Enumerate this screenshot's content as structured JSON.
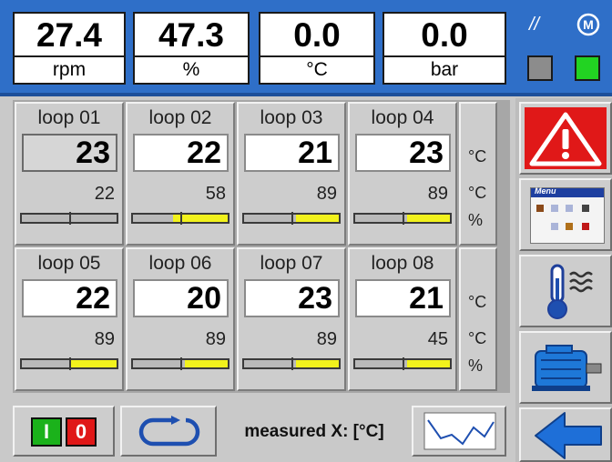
{
  "readouts": [
    {
      "value": "27.4",
      "unit": "rpm"
    },
    {
      "value": "47.3",
      "unit": "%"
    },
    {
      "value": "0.0",
      "unit": "°C"
    },
    {
      "value": "0.0",
      "unit": "bar"
    }
  ],
  "status": {
    "mode_icon_text": "//",
    "m_icon_text": "M",
    "indicator_left_color": "#8c8c8c",
    "indicator_right_color": "#22d322"
  },
  "loops": [
    {
      "name": "loop 01",
      "setpoint": "23",
      "measured": "22",
      "level": 0.0,
      "selected": true
    },
    {
      "name": "loop 02",
      "setpoint": "22",
      "measured": "58",
      "level": 0.58,
      "selected": false
    },
    {
      "name": "loop 03",
      "setpoint": "21",
      "measured": "89",
      "level": 0.45,
      "selected": false
    },
    {
      "name": "loop 04",
      "setpoint": "23",
      "measured": "89",
      "level": 0.45,
      "selected": false
    },
    {
      "name": "loop 05",
      "setpoint": "22",
      "measured": "89",
      "level": 0.48,
      "selected": false
    },
    {
      "name": "loop 06",
      "setpoint": "20",
      "measured": "89",
      "level": 0.45,
      "selected": false
    },
    {
      "name": "loop 07",
      "setpoint": "23",
      "measured": "89",
      "level": 0.45,
      "selected": false
    },
    {
      "name": "loop 08",
      "setpoint": "21",
      "measured": "45",
      "level": 0.45,
      "selected": false
    }
  ],
  "units": {
    "setpoint": "°C",
    "measured": "°C",
    "output": "%"
  },
  "toolbar": {
    "on_label": "I",
    "off_label": "0",
    "measured_label": "measured X: [°C]"
  },
  "colors": {
    "header_blue": "#2f6fc8",
    "warning_red": "#e01818",
    "bar_yellow": "#f2f21c",
    "arrow_blue": "#1e6fd8"
  },
  "icons": {
    "alarm": "warning-triangle-icon",
    "menu": "menu-icon",
    "temperature": "thermometer-icon",
    "motor": "motor-icon",
    "back": "back-arrow-icon",
    "cycle": "cycle-icon",
    "trend": "trend-chart-icon"
  },
  "menu_icon_text": "Menu"
}
